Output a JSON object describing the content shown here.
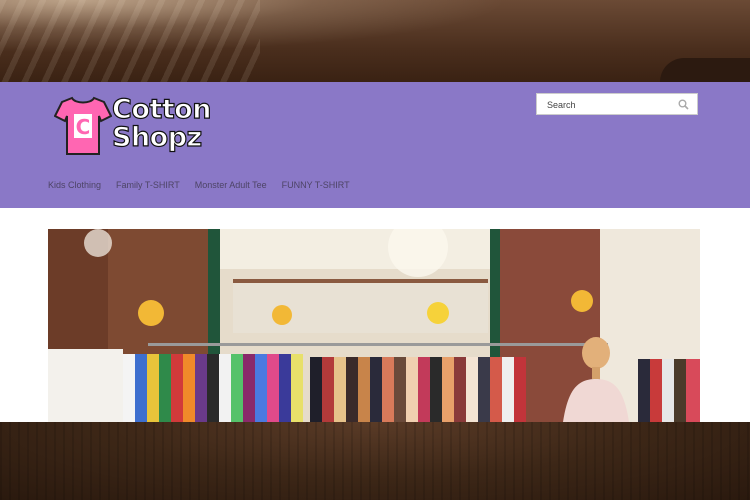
{
  "brand": {
    "name_line1": "Cotton",
    "name_line2": "Shopz",
    "logo_letter": "C",
    "colors": {
      "header_bg": "#8a78c7",
      "shirt": "#ff66b2"
    }
  },
  "search": {
    "placeholder": "Search",
    "icon": "search-icon"
  },
  "nav": {
    "items": [
      {
        "label": "Kids Clothing"
      },
      {
        "label": "Family T-SHIRT"
      },
      {
        "label": "Monster Adult Tee"
      },
      {
        "label": "FUNNY T-SHIRT"
      }
    ]
  },
  "banner": {
    "description": "clothing store photo"
  }
}
